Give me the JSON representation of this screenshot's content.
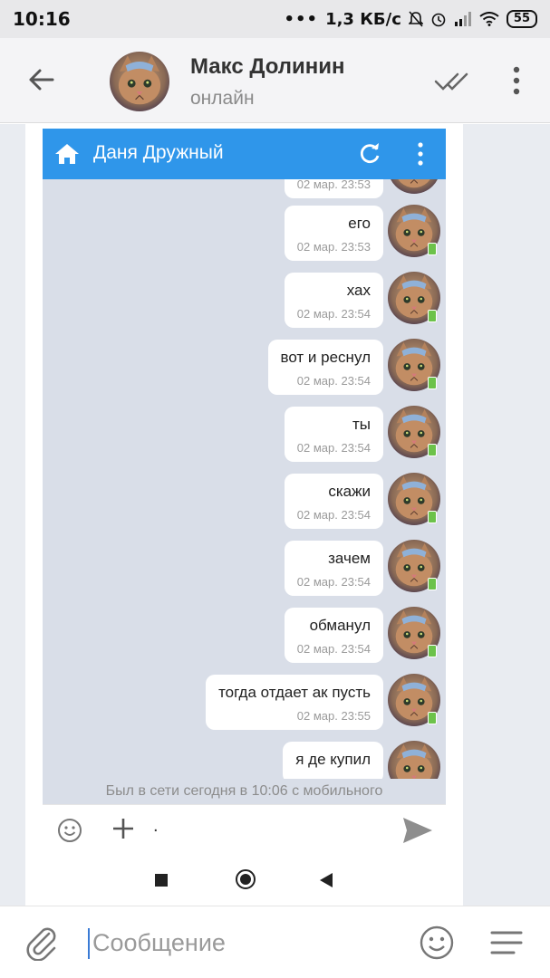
{
  "status_bar": {
    "time": "10:16",
    "dots": "•••",
    "speed": "1,3 КБ/с",
    "battery": "55"
  },
  "header": {
    "name": "Макс Долинин",
    "status": "онлайн"
  },
  "embedded": {
    "title": "Даня Дружный",
    "partial_time": "02 мар. 23:53",
    "messages": [
      {
        "text": "его",
        "time": "02 мар. 23:53"
      },
      {
        "text": "хах",
        "time": "02 мар. 23:54"
      },
      {
        "text": "вот и реснул",
        "time": "02 мар. 23:54"
      },
      {
        "text": "ты",
        "time": "02 мар. 23:54"
      },
      {
        "text": "скажи",
        "time": "02 мар. 23:54"
      },
      {
        "text": "зачем",
        "time": "02 мар. 23:54"
      },
      {
        "text": "обманул",
        "time": "02 мар. 23:54"
      },
      {
        "text": "тогда отдает ак пусть",
        "time": "02 мар. 23:55"
      },
      {
        "text": "я де купил",
        "time": ""
      }
    ],
    "last_seen": "Был в сети сегодня в 10:06 с мобильного",
    "input_text": "."
  },
  "bottom": {
    "placeholder": "Сообщение"
  },
  "colors": {
    "accent": "#2f96ea",
    "bubble_bg": "#ffffff",
    "chat_bg": "#d9dee8",
    "online": "#6cc24a"
  },
  "icons": [
    "back-arrow-icon",
    "double-check-icon",
    "more-vertical-icon",
    "home-icon",
    "refresh-icon",
    "emoji-icon",
    "plus-icon",
    "send-icon",
    "paperclip-icon",
    "menu-icon"
  ]
}
